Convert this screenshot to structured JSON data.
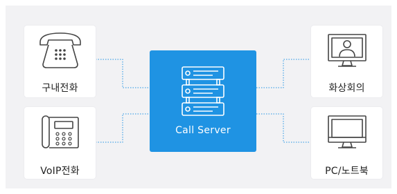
{
  "devices": {
    "landline": {
      "label": "구내전화",
      "icon": "rotary-phone-icon"
    },
    "voip": {
      "label": "VoIP전화",
      "icon": "voip-phone-icon"
    },
    "video_conference": {
      "label": "화상회의",
      "icon": "video-call-monitor-icon"
    },
    "pc_notebook": {
      "label": "PC/노트북",
      "icon": "monitor-icon"
    }
  },
  "server": {
    "label": "Call Server",
    "icon": "server-rack-icon"
  },
  "colors": {
    "accent": "#1f93e3",
    "icon_stroke": "#444444",
    "connector": "#1f93e3",
    "background": "#f2f2f4"
  }
}
